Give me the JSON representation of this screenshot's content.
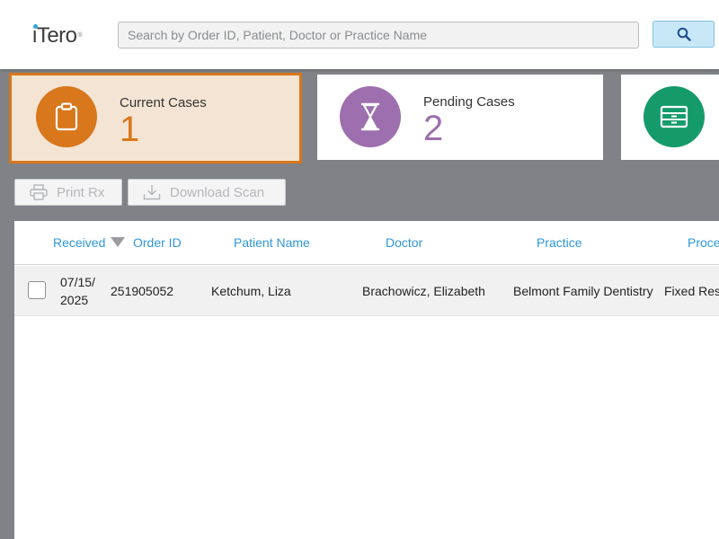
{
  "header": {
    "logo_text": "iTero",
    "logo_mark": "®",
    "search_placeholder": "Search by Order ID, Patient, Doctor or Practice Name",
    "search_icon": "search-icon"
  },
  "cards": [
    {
      "title": "Current Cases",
      "count": "1",
      "icon": "clipboard-icon",
      "color": "#d8771b",
      "active": true
    },
    {
      "title": "Pending Cases",
      "count": "2",
      "icon": "hourglass-icon",
      "color": "#9e6fae",
      "active": false
    },
    {
      "title": "",
      "count": "",
      "icon": "archive-icon",
      "color": "#159b69",
      "active": false
    }
  ],
  "actions": {
    "print_rx": "Print Rx",
    "download_scan": "Download Scan"
  },
  "table": {
    "columns": [
      "Received",
      "Order ID",
      "Patient Name",
      "Doctor",
      "Practice",
      "Proce"
    ],
    "sort_column": "Received",
    "sort_direction": "descending",
    "rows": [
      {
        "received": "07/15/ 2025",
        "order_id": "251905052",
        "patient_name": "Ketchum, Liza",
        "doctor": "Brachowicz, Elizabeth",
        "practice": "Belmont Family Dentistry",
        "procedure": "Fixed Res",
        "checked": false
      }
    ]
  },
  "colors": {
    "accent_blue": "#2e97d8",
    "current_orange": "#d8771b",
    "pending_purple": "#9e6fae",
    "archive_green": "#159b69"
  }
}
